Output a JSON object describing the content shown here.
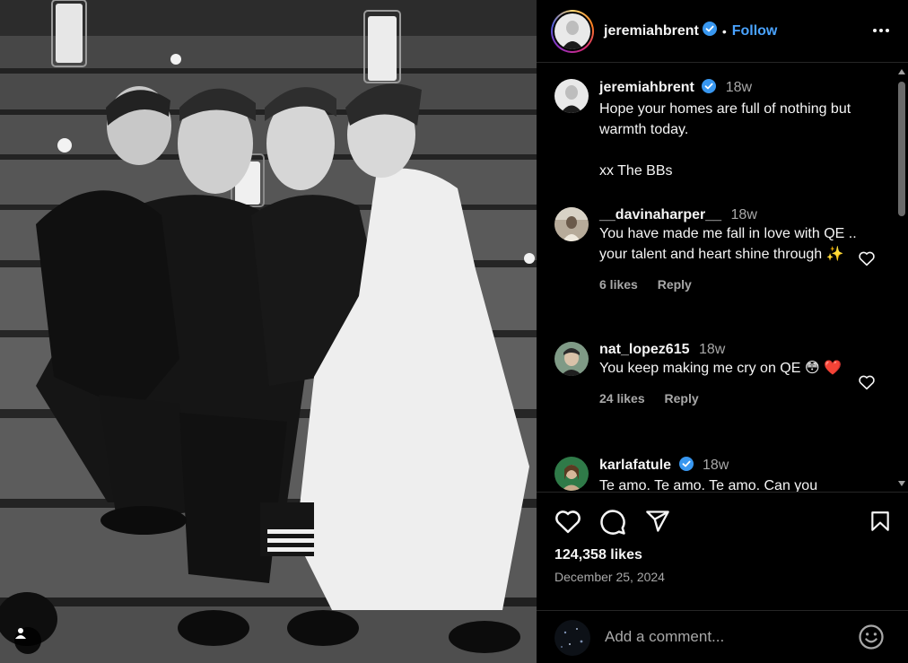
{
  "post": {
    "author": "jeremiahbrent",
    "follow_label": "Follow",
    "dot": "•",
    "caption": {
      "author": "jeremiahbrent",
      "age": "18w",
      "text": "Hope your homes are full of nothing but warmth today.\n\nxx The BBs"
    },
    "likes": "124,358 likes",
    "date": "December 25, 2024"
  },
  "comments": [
    {
      "user": "__davinaharper__",
      "age": "18w",
      "text": "You have made me fall in love with QE .. your talent and heart shine through ✨",
      "likes": "6 likes",
      "reply": "Reply",
      "verified": false
    },
    {
      "user": "nat_lopez615",
      "age": "18w",
      "text": "You keep making me cry on QE 😳 ❤️",
      "likes": "24 likes",
      "reply": "Reply",
      "verified": false
    },
    {
      "user": "karlafatule",
      "age": "18w",
      "text": "Te amo. Te amo. Te amo. Can you",
      "verified": true
    }
  ],
  "add_comment": {
    "placeholder": "Add a comment..."
  },
  "colors": {
    "accent": "#4aa3ff",
    "verified": "#3897f0",
    "heart_red": "#ed4956",
    "muted": "#a8a8a8"
  },
  "icons": [
    "verified-icon",
    "more-icon",
    "heart-icon",
    "comment-icon",
    "share-icon",
    "bookmark-icon",
    "emoji-icon",
    "user-tag-icon"
  ]
}
